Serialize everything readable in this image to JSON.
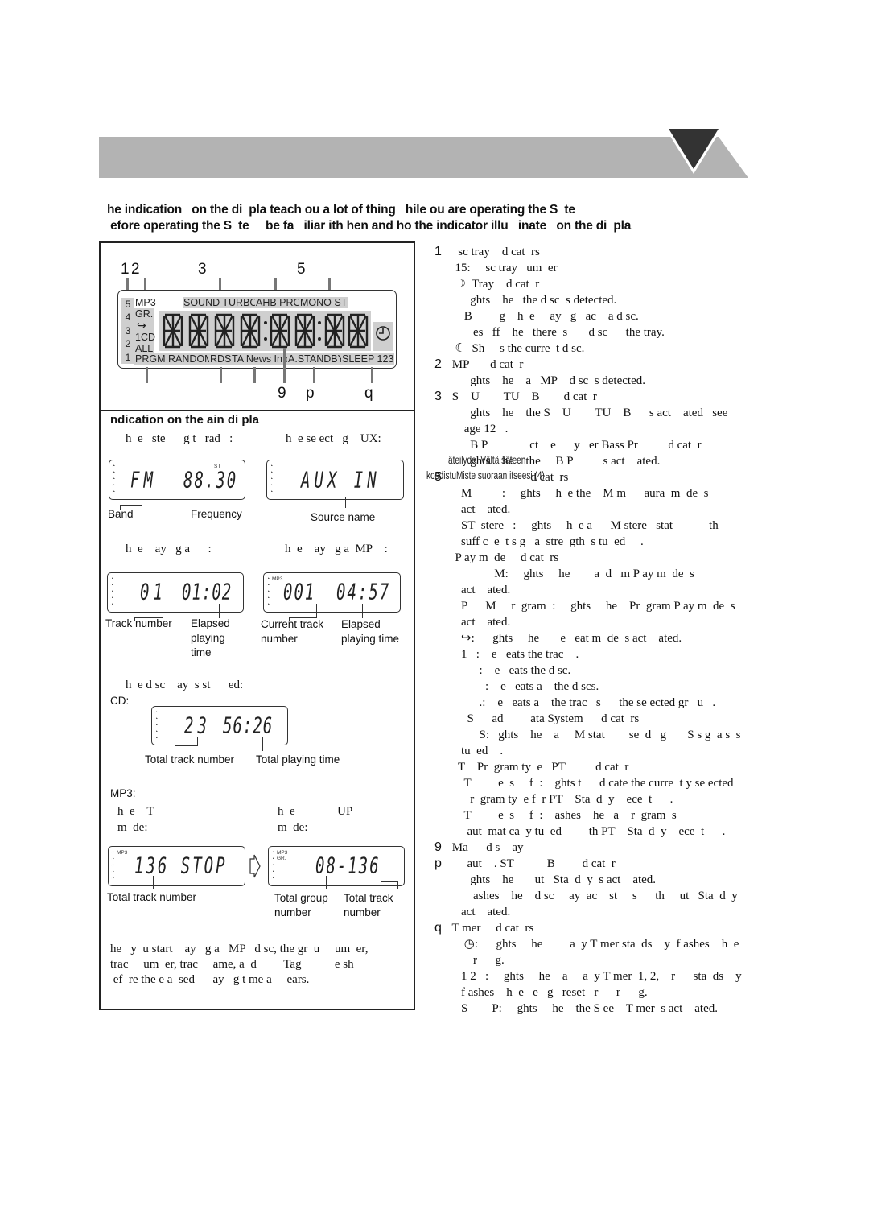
{
  "header": {
    "band_color": "#b3b3b3",
    "triangle_color": "#333333"
  },
  "intro": {
    "line1": "he indication   on the di  pla teach ou a lot of thing   hile ou are operating the S  te",
    "line2": " efore operating the S  te     be fa   iliar ith hen and ho the indicator illu   inate   on the di  pla"
  },
  "main_display": {
    "callouts_top": [
      "1",
      "2",
      "3",
      "5"
    ],
    "callouts_bottom": [
      "9",
      "p",
      "q"
    ],
    "disc_numbers": [
      "5",
      "4",
      "3",
      "2",
      "1"
    ],
    "labels": {
      "mp3": "MP3",
      "gr": "GR.",
      "one_cd": "1CD",
      "all": "ALL",
      "prgm_random": "PRGM RANDOM",
      "rds": "RDS",
      "ta_news_info": "TA News Info",
      "a_standby": "A.STANDBY",
      "sleep_123": "SLEEP 123",
      "sound_turbo": "SOUND TURBO",
      "ahb_pro": "AHB PRO",
      "mono_st": "MONO ST"
    },
    "segments": "8888:88:88"
  },
  "indications": {
    "title": "ndication   on the    ain di  pla",
    "radio_caption": "h  e   ste      g t   rad   :",
    "aux_caption": "h  e se ect   g    UX:",
    "radio_lcd": {
      "band": "FM",
      "freq": "88.30",
      "st": "ST"
    },
    "radio_labels": {
      "band": "Band",
      "frequency": "Frequency"
    },
    "aux_lcd": {
      "text": "AUX IN"
    },
    "aux_label": "Source name",
    "cd_play_caption": "h  e    ay   g a      :",
    "mp3_play_caption": "h  e    ay   g a  MP    :",
    "cd_play_lcd": {
      "track": "01",
      "time": "01:02"
    },
    "cd_play_labels": {
      "track": "Track number",
      "elapsed": "Elapsed\nplaying\ntime"
    },
    "mp3_play_lcd": {
      "tag": "MP3",
      "track": "001",
      "time": "04:57"
    },
    "mp3_play_labels": {
      "track": "Current track\nnumber",
      "elapsed": "Elapsed\nplaying time"
    },
    "stopped_caption": "h  e d sc    ay  s st      ed:",
    "cd_label": "CD:",
    "cd_stop_lcd": {
      "tracks": "23",
      "time": "56:26"
    },
    "cd_stop_labels": {
      "tracks": "Total track number",
      "time": "Total playing time"
    },
    "mp3_label": "MP3:",
    "track_mode_caption": "h  e    T\nm  de:",
    "group_mode_caption": "h  e              UP\nm  de:",
    "mp3_track_lcd": {
      "tag": "MP3",
      "text": "136 STOP"
    },
    "mp3_track_label": "Total track number",
    "mp3_group_lcd": {
      "tag": "MP3",
      "tag2": "GR.",
      "text": "08-136"
    },
    "mp3_group_labels": {
      "group": "Total group\nnumber",
      "track": "Total track\nnumber"
    },
    "footnote": "he   y  u start    ay   g a   MP   d sc, the gr  u     um  er,\ntrac     um  er, trac     ame, a  d         Tag           e sh\n ef  re the e a  sed      ay   g t me a     ears."
  },
  "descriptions": [
    {
      "num": "1",
      "text": "   sc tray    d cat  rs"
    },
    {
      "num": "",
      "text": "  15:     sc tray   um  er"
    },
    {
      "num": "",
      "text": "  ☽  Tray    d cat  r"
    },
    {
      "num": "",
      "text": "       ghts    he   the d sc  s detected."
    },
    {
      "num": "",
      "text": "     B         g    h  e     ay   g   ac    a d sc."
    },
    {
      "num": "",
      "text": "        es   ff    he   there  s       d sc      the tray."
    },
    {
      "num": "",
      "text": "  ☾  Sh     s the curre  t d sc."
    },
    {
      "num": "2",
      "text": " MP       d cat  r"
    },
    {
      "num": "",
      "text": "       ghts    he    a   MP    d sc  s detected."
    },
    {
      "num": "3",
      "text": " S    U        TU    B        d cat  r"
    },
    {
      "num": "",
      "text": "       ghts    he    the S    U        TU    B      s act    ated   see"
    },
    {
      "num": "",
      "text": "     age 12   ."
    },
    {
      "num": "",
      "text": "       B P              ct    e      y   er Bass Pr          d cat  r"
    },
    {
      "num": "",
      "text": "       ghts    he    the     B P          s act    ated."
    },
    {
      "num": "5",
      "text": "                           d cat  rs"
    },
    {
      "num": "",
      "text": "    M          :     ghts     h  e the    M m      aura  m  de  s"
    },
    {
      "num": "",
      "text": "    act    ated."
    },
    {
      "num": "",
      "text": "    ST  stere   :     ghts     h  e a      M stere   stat            th"
    },
    {
      "num": "",
      "text": "    suff c  e  t s g   a  stre  gth  s tu  ed     ."
    },
    {
      "num": "",
      "text": "  P ay m  de     d cat  rs"
    },
    {
      "num": "",
      "text": "               M:     ghts     he        a  d   m P ay m  de  s"
    },
    {
      "num": "",
      "text": "    act    ated."
    },
    {
      "num": "",
      "text": "    P      M     r  gram  :     ghts     he    Pr  gram P ay m  de  s"
    },
    {
      "num": "",
      "text": "    act    ated."
    },
    {
      "num": "",
      "text": "    ↪:      ghts     he       e   eat m  de  s act    ated."
    },
    {
      "num": "",
      "text": "    1   :    e   eats the trac    ."
    },
    {
      "num": "",
      "text": "          :    e   eats the d sc."
    },
    {
      "num": "",
      "text": "            :    e   eats a    the d scs."
    },
    {
      "num": "",
      "text": "          .:    e   eats a    the trac   s      the se ected gr   u   ."
    },
    {
      "num": "",
      "text": "      S      ad         ata System      d cat  rs"
    },
    {
      "num": "",
      "text": "          S:   ghts    he    a     M stat        se  d   g       S s g  a s  s"
    },
    {
      "num": "",
      "text": "    tu  ed    ."
    },
    {
      "num": "",
      "text": "   T    Pr  gram ty  e   PT          d cat  r"
    },
    {
      "num": "",
      "text": "     T         e  s     f  :    ghts t      d cate the curre  t y se ected"
    },
    {
      "num": "",
      "text": "       r  gram ty  e f  r PT    Sta  d  y    ece  t      ."
    },
    {
      "num": "",
      "text": "     T         e  s     f  :    ashes    he   a    r  gram  s"
    },
    {
      "num": "",
      "text": "      aut  mat ca  y tu  ed         th PT    Sta  d  y    ece  t      ."
    },
    {
      "num": "9",
      "text": " Ma      d s    ay"
    },
    {
      "num": "p",
      "text": "      aut    . ST           B         d cat  r"
    },
    {
      "num": "",
      "text": "       ghts    he       ut   Sta  d  y  s act    ated."
    },
    {
      "num": "",
      "text": "        ashes    he    d sc     ay  ac    st     s      th     ut   Sta  d  y"
    },
    {
      "num": "",
      "text": "    act    ated."
    },
    {
      "num": "q",
      "text": " T mer     d cat  rs"
    },
    {
      "num": "",
      "text": "     ◷:      ghts     he         a  y T mer sta  ds    y  f ashes    h  e"
    },
    {
      "num": "",
      "text": "        r      g."
    },
    {
      "num": "",
      "text": "    1 2   :     ghts     he    a     a  y T mer  1, 2,    r      sta  ds    y"
    },
    {
      "num": "",
      "text": "    f ashes    h  e   e   g   reset   r      r      g."
    },
    {
      "num": "",
      "text": "    S        P:     ghts     he    the S ee    T mer  s act    ated."
    }
  ],
  "overlap_text": {
    "line1": "äteilyde.  Vältä   säteen",
    "line2": "kosdistuMiste suoraan itseesi (4)"
  }
}
